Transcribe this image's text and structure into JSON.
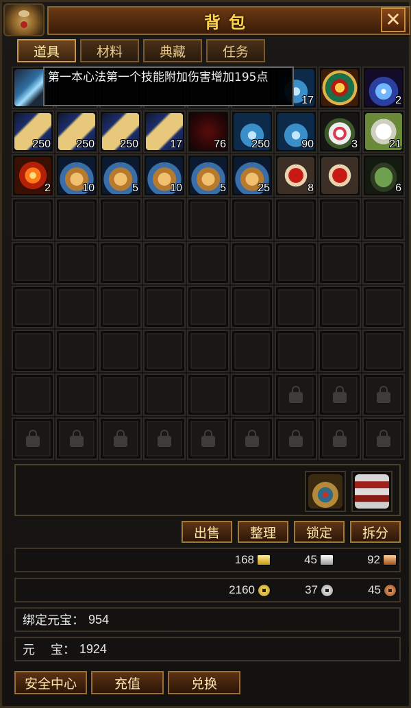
{
  "window": {
    "title": "背包",
    "close_label": "✕"
  },
  "tabs": [
    {
      "label": "道具",
      "active": true
    },
    {
      "label": "材料",
      "active": false
    },
    {
      "label": "典藏",
      "active": false
    },
    {
      "label": "任务",
      "active": false
    }
  ],
  "tooltip": "第一本心法第一个技能附加伤害增加195点",
  "grid": {
    "rows": [
      [
        {
          "icon": "blade-icon",
          "art": "blade",
          "count": ""
        },
        {
          "icon": "hidden-icon",
          "art": "",
          "count": ""
        },
        {
          "icon": "hidden-icon",
          "art": "",
          "count": ""
        },
        {
          "icon": "hidden-icon",
          "art": "",
          "count": ""
        },
        {
          "icon": "hidden-icon",
          "art": "",
          "count": ""
        },
        {
          "icon": "hidden-icon",
          "art": "",
          "count": ""
        },
        {
          "icon": "potion-icon",
          "art": "vase",
          "count": "17"
        },
        {
          "icon": "compass-icon",
          "art": "compass",
          "count": ""
        },
        {
          "icon": "spirit-orb-icon",
          "art": "orb",
          "count": "2"
        }
      ],
      [
        {
          "icon": "scroll-icon",
          "art": "scroll",
          "count": "250"
        },
        {
          "icon": "scroll-icon",
          "art": "scroll",
          "count": "250"
        },
        {
          "icon": "scroll-icon",
          "art": "scroll",
          "count": "250"
        },
        {
          "icon": "scroll-icon",
          "art": "scroll",
          "count": "17"
        },
        {
          "icon": "claw-icon",
          "art": "claw",
          "count": "76"
        },
        {
          "icon": "vase-icon",
          "art": "vase",
          "count": "250"
        },
        {
          "icon": "vase-icon",
          "art": "vase",
          "count": "90"
        },
        {
          "icon": "gourd-icon",
          "art": "gourd",
          "count": "3"
        },
        {
          "icon": "robe-icon",
          "art": "robe",
          "count": "21"
        }
      ],
      [
        {
          "icon": "gear-orb-icon",
          "art": "gear",
          "count": "2"
        },
        {
          "icon": "teapot-icon",
          "art": "pot",
          "count": "10"
        },
        {
          "icon": "teapot-icon",
          "art": "pot",
          "count": "5"
        },
        {
          "icon": "teapot-icon",
          "art": "pot",
          "count": "10"
        },
        {
          "icon": "teapot-icon",
          "art": "pot",
          "count": "5"
        },
        {
          "icon": "teapot-icon",
          "art": "pot",
          "count": "25"
        },
        {
          "icon": "red-powder-icon",
          "art": "dishr",
          "count": "8"
        },
        {
          "icon": "red-powder-icon",
          "art": "dishr",
          "count": ""
        },
        {
          "icon": "green-powder-icon",
          "art": "dishg",
          "count": "6"
        }
      ]
    ],
    "empty_rows": 4,
    "partial_row_locked_from": 6,
    "locked_rows": 1
  },
  "shop_items": [
    {
      "icon": "lucky-bag-icon"
    },
    {
      "icon": "treasure-chest-icon"
    }
  ],
  "actions": [
    "出售",
    "整理",
    "锁定",
    "拆分"
  ],
  "currency_ingots": [
    {
      "value": "168",
      "icon": "gold-ingot-icon"
    },
    {
      "value": "45",
      "icon": "silver-ingot-icon"
    },
    {
      "value": "92",
      "icon": "copper-ingot-icon"
    }
  ],
  "currency_coins": [
    {
      "value": "2160",
      "icon": "gold-coin-icon"
    },
    {
      "value": "37",
      "icon": "silver-coin-icon"
    },
    {
      "value": "45",
      "icon": "copper-coin-icon"
    }
  ],
  "bound_yuanbao": {
    "label": "绑定元宝：",
    "value": "954"
  },
  "yuanbao": {
    "label": "元    宝：",
    "value": "1924"
  },
  "bottom_buttons": [
    "安全中心",
    "充值",
    "兑换"
  ]
}
